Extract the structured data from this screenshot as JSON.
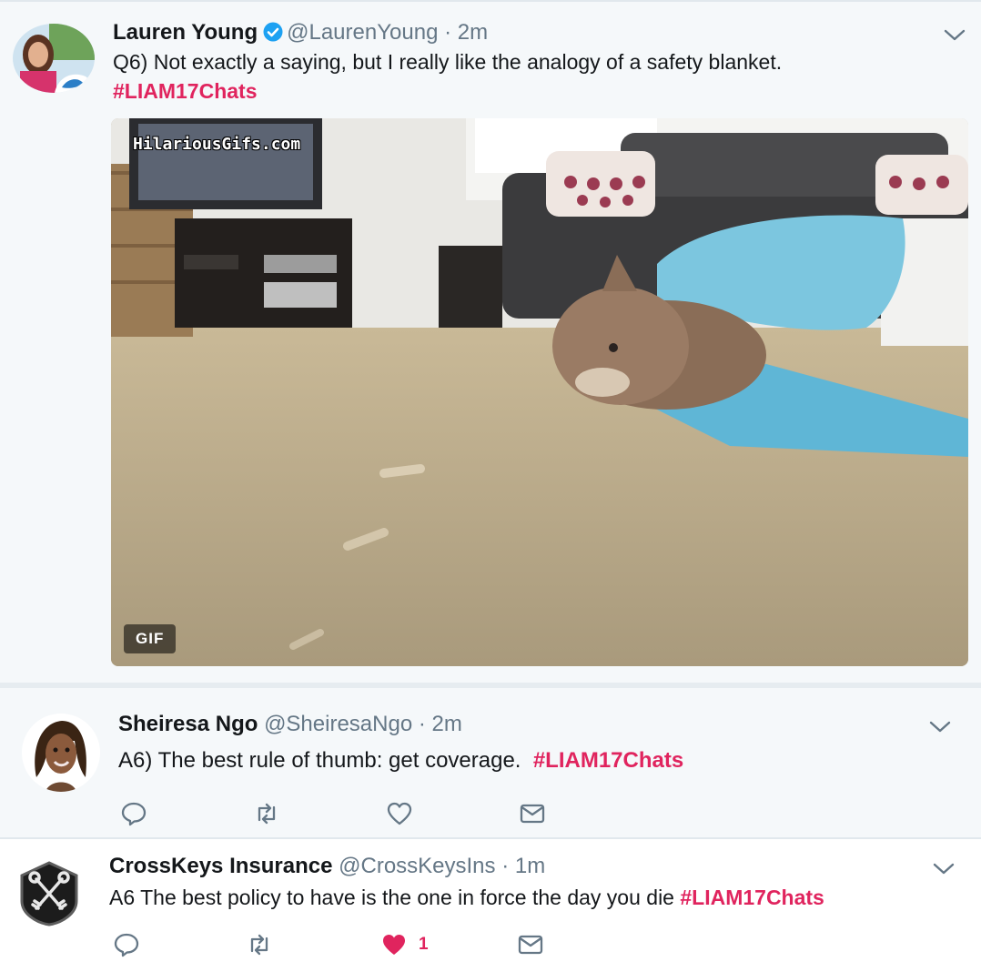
{
  "tweets": [
    {
      "name": "Lauren Young",
      "handle": "@LaurenYoung",
      "separator": "·",
      "time": "2m",
      "text": "Q6) Not exactly a saying, but I really like the analogy of a safety blanket.",
      "hashtag": "#LIAM17Chats",
      "media": {
        "watermark": "HilariousGifs.com",
        "badge": "GIF"
      }
    },
    {
      "name": "Sheiresa Ngo",
      "handle": "@SheiresaNgo",
      "separator": "·",
      "time": "2m",
      "text": "A6) The best rule of thumb: get coverage.",
      "hashtag": "#LIAM17Chats"
    },
    {
      "name": "CrossKeys Insurance",
      "handle": "@CrossKeysIns",
      "separator": "·",
      "time": "1m",
      "text": "A6 The best policy to have is the one in force the day you die",
      "hashtag": "#LIAM17Chats",
      "like_count": "1"
    }
  ],
  "colors": {
    "hashtag": "#e0245e",
    "verified": "#1da1f2",
    "icon": "#657786",
    "liked": "#e0245e"
  }
}
